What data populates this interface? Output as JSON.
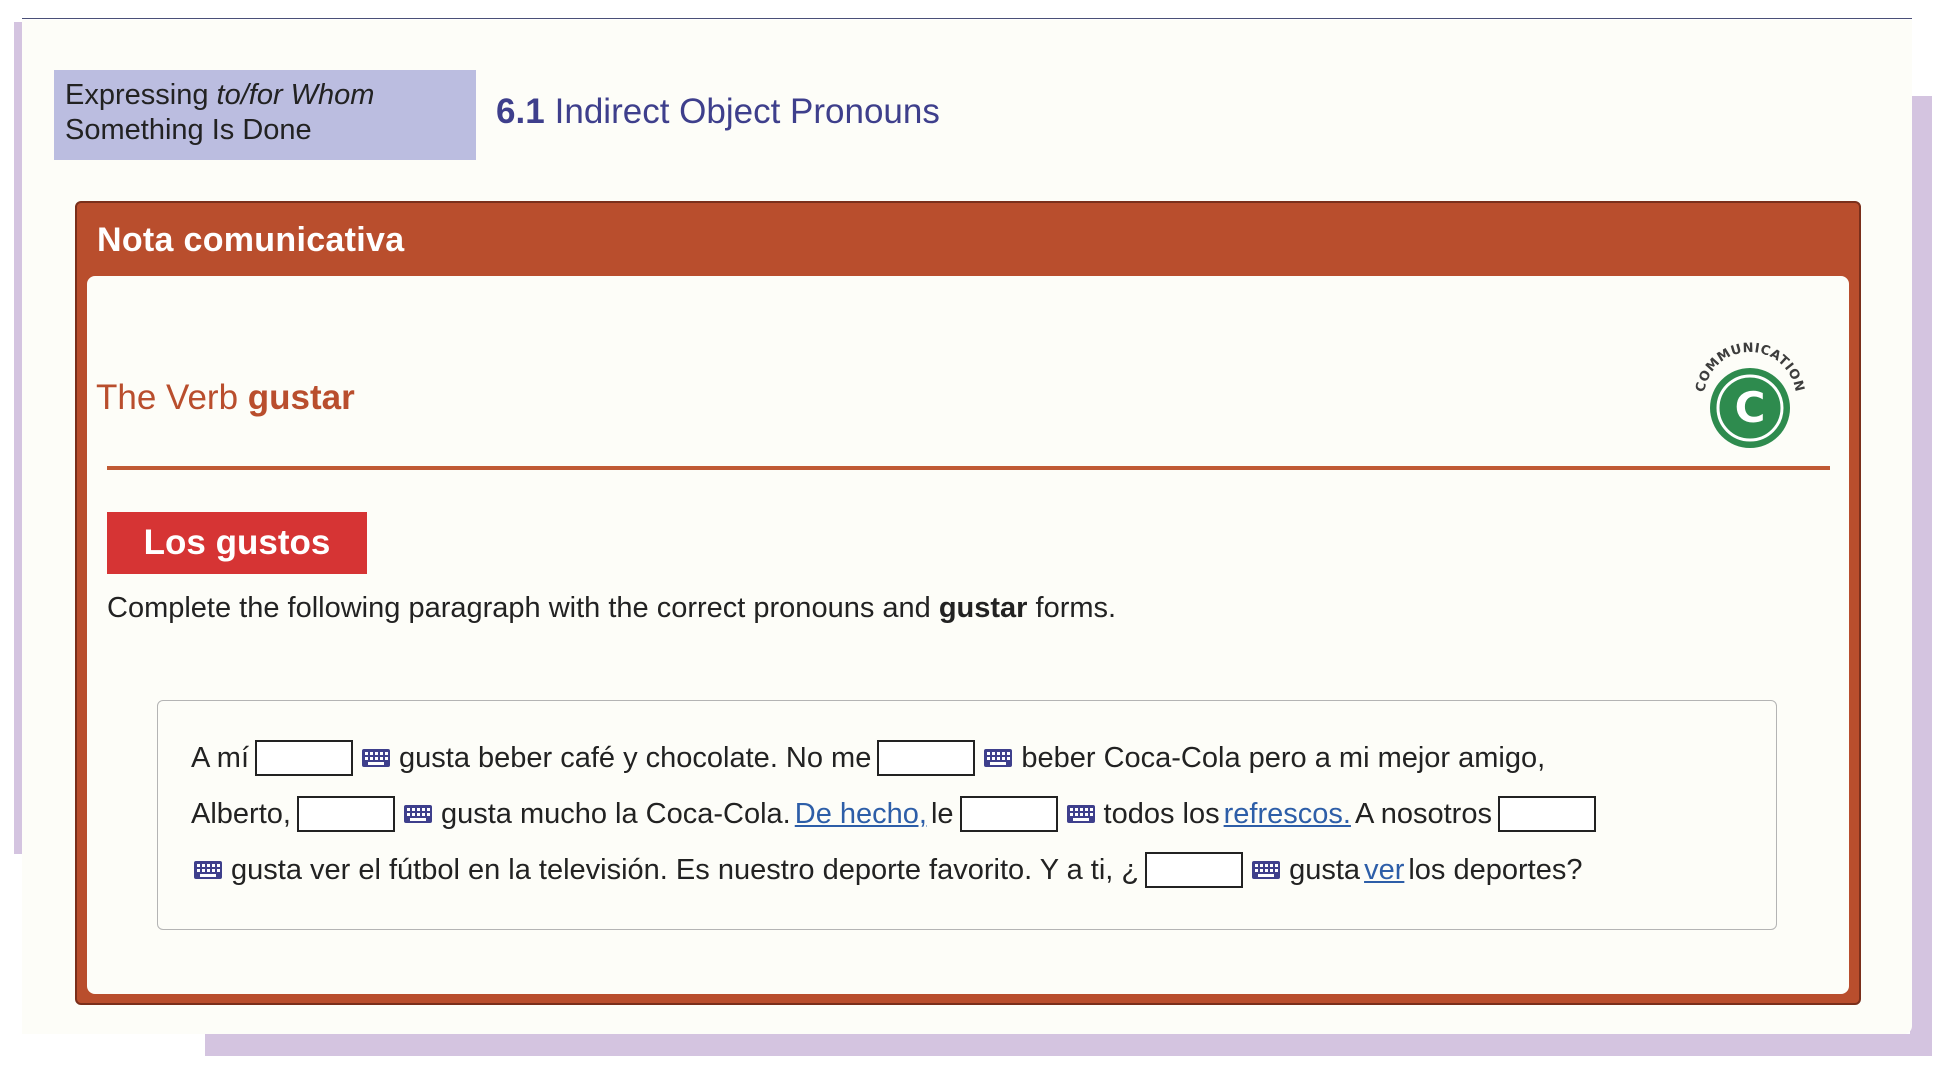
{
  "chapter_label": {
    "line1_prefix": "Expressing ",
    "line1_italic": "to/for Whom",
    "line2": "Something Is Done"
  },
  "section": {
    "number": "6.1",
    "title": "Indirect Object Pronouns"
  },
  "nota": {
    "header": "Nota comunicativa"
  },
  "verb_title": {
    "prefix": "The Verb ",
    "bold": "gustar"
  },
  "badge": {
    "text": "COMMUNICATION",
    "letter": "C",
    "color": "#2e8b4e"
  },
  "activity": {
    "title": "Los gustos",
    "instructions_pre": "Complete the following paragraph with the correct pronouns and ",
    "instructions_bold": "gustar",
    "instructions_post": " forms."
  },
  "exercise": {
    "t1": "A mí",
    "t2": "gusta beber café y chocolate. No me",
    "t3": "beber Coca-Cola pero a mi mejor amigo,",
    "t4": "Alberto,",
    "t5": "gusta mucho la Coca-Cola.",
    "link1": "De hecho,",
    "t6": "le",
    "t7": "todos los",
    "link2": "refrescos.",
    "t8": "A nosotros",
    "t9": "gusta ver el fútbol en la televisión. Es nuestro deporte favorito. Y a ti, ¿",
    "t10": "gusta",
    "link3": "ver",
    "t11": "los deportes?",
    "blank_values": [
      "",
      "",
      "",
      "",
      "",
      ""
    ]
  },
  "colors": {
    "accent_orange": "#b94e2d",
    "section_blue": "#3e3f8c",
    "activity_red": "#d63434",
    "link_blue": "#2d5ea8",
    "chapter_bg": "#bbbde0"
  }
}
